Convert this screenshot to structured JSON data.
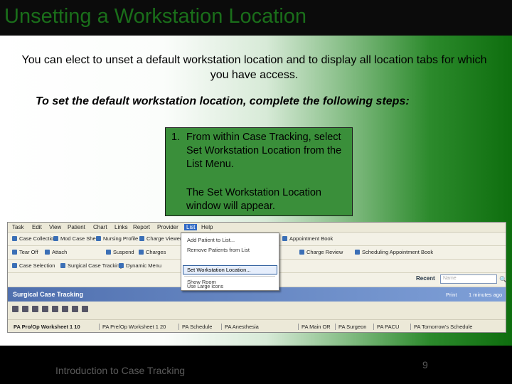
{
  "slide": {
    "title": "Unsetting a Workstation Location",
    "intro": "You can elect to unset a default workstation location and to display all location tabs for which you have access.",
    "steps_heading": "To set the default workstation location, complete the following steps:",
    "step": {
      "number": "1.",
      "text": "From within Case Tracking, select Set Workstation Location from the List Menu.",
      "result": "The Set Workstation Location window will appear."
    },
    "footer": "Introduction to Case Tracking",
    "page_number": "9"
  },
  "app": {
    "menu": [
      "Task",
      "Edit",
      "View",
      "Patient",
      "Chart",
      "Links",
      "Report",
      "Provider",
      "List",
      "Help"
    ],
    "toolbar1": [
      "Case Collection",
      "Mod Case Sheet",
      "Nursing Profile",
      "Charge Viewer",
      "Appointment Book"
    ],
    "toolbar2": [
      "Tear Off",
      "Attach",
      "Suspend",
      "Charges",
      "Charge Review",
      "Scheduling Appointment Book"
    ],
    "toolbar3": [
      "Case Selection",
      "Surgical Case Tracking",
      "Dynamic Menu"
    ],
    "dropdown_items": [
      "Add Patient to List...",
      "Remove Patients from List",
      "Set Workstation Location...",
      "Show Room",
      "Use Large Icons"
    ],
    "selected_item": "Set Workstation Location...",
    "recent_label": "Recent",
    "name_placeholder": "Name",
    "section_title": "Surgical Case Tracking",
    "print_label": "Print",
    "minutes_label": "1 minutes ago",
    "location_tabs": [
      "PA Pro/Op Worksheet 1 10",
      "PA Pre/Op Worksheet 1 20",
      "PA Schedule",
      "PA Anesthesia",
      "PA Main OR",
      "PA Surgeon",
      "PA PACU",
      "PA Tomorrow's Schedule"
    ]
  },
  "colors": {
    "title": "#1a6e1a",
    "step_box": "#3a8f3a",
    "band": "#4f6fae"
  }
}
